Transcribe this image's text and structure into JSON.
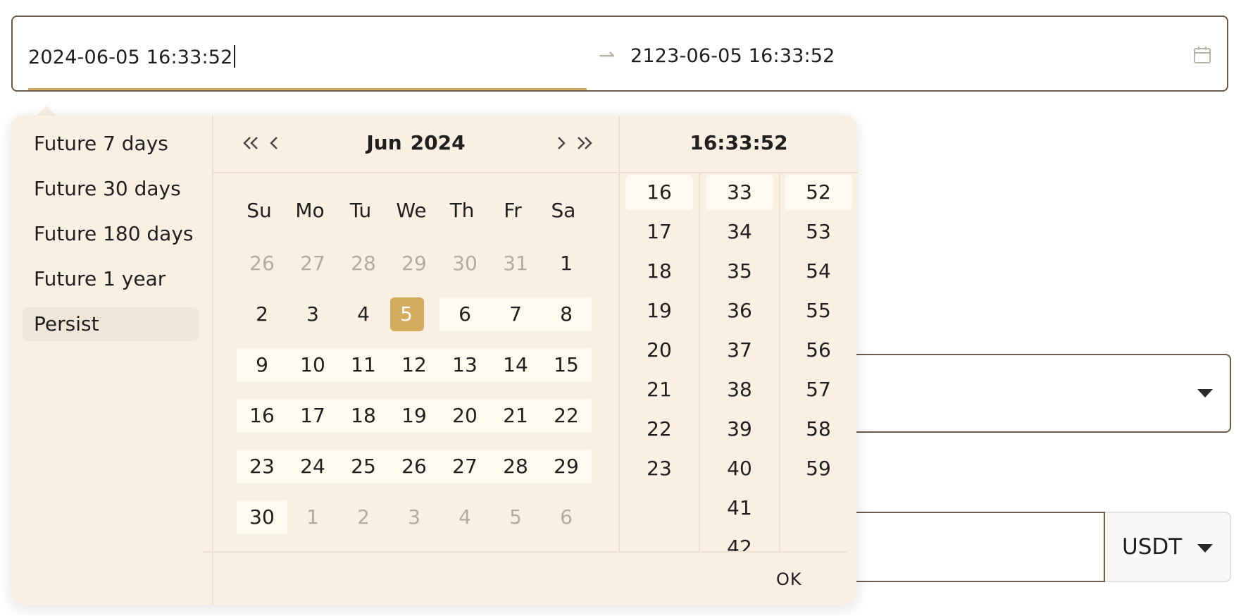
{
  "range": {
    "start": "2024-06-05 16:33:52",
    "separator": "⇀",
    "end": "2123-06-05 16:33:52"
  },
  "presets": [
    "Future 7 days",
    "Future 30 days",
    "Future 180 days",
    "Future 1 year",
    "Persist"
  ],
  "calendar": {
    "month": "Jun",
    "year": "2024",
    "weekdays": [
      "Su",
      "Mo",
      "Tu",
      "We",
      "Th",
      "Fr",
      "Sa"
    ],
    "weeks": [
      [
        {
          "d": "26",
          "s": "dim"
        },
        {
          "d": "27",
          "s": "dim"
        },
        {
          "d": "28",
          "s": "dim"
        },
        {
          "d": "29",
          "s": "dim"
        },
        {
          "d": "30",
          "s": "dim"
        },
        {
          "d": "31",
          "s": "dim"
        },
        {
          "d": "1",
          "s": ""
        }
      ],
      [
        {
          "d": "2",
          "s": ""
        },
        {
          "d": "3",
          "s": ""
        },
        {
          "d": "4",
          "s": ""
        },
        {
          "d": "5",
          "s": "sel"
        },
        {
          "d": "6",
          "s": "inrange"
        },
        {
          "d": "7",
          "s": "inrange"
        },
        {
          "d": "8",
          "s": "inrange"
        }
      ],
      [
        {
          "d": "9",
          "s": "inrange"
        },
        {
          "d": "10",
          "s": "inrange"
        },
        {
          "d": "11",
          "s": "inrange"
        },
        {
          "d": "12",
          "s": "inrange"
        },
        {
          "d": "13",
          "s": "inrange"
        },
        {
          "d": "14",
          "s": "inrange"
        },
        {
          "d": "15",
          "s": "inrange"
        }
      ],
      [
        {
          "d": "16",
          "s": "inrange"
        },
        {
          "d": "17",
          "s": "inrange"
        },
        {
          "d": "18",
          "s": "inrange"
        },
        {
          "d": "19",
          "s": "inrange"
        },
        {
          "d": "20",
          "s": "inrange"
        },
        {
          "d": "21",
          "s": "inrange"
        },
        {
          "d": "22",
          "s": "inrange"
        }
      ],
      [
        {
          "d": "23",
          "s": "inrange"
        },
        {
          "d": "24",
          "s": "inrange"
        },
        {
          "d": "25",
          "s": "inrange"
        },
        {
          "d": "26",
          "s": "inrange"
        },
        {
          "d": "27",
          "s": "inrange"
        },
        {
          "d": "28",
          "s": "inrange"
        },
        {
          "d": "29",
          "s": "inrange"
        }
      ],
      [
        {
          "d": "30",
          "s": "inrange"
        },
        {
          "d": "1",
          "s": "dim"
        },
        {
          "d": "2",
          "s": "dim"
        },
        {
          "d": "3",
          "s": "dim"
        },
        {
          "d": "4",
          "s": "dim"
        },
        {
          "d": "5",
          "s": "dim"
        },
        {
          "d": "6",
          "s": "dim"
        }
      ]
    ]
  },
  "time": {
    "title": "16:33:52",
    "hours": [
      "16",
      "17",
      "18",
      "19",
      "20",
      "21",
      "22",
      "23"
    ],
    "minutes": [
      "33",
      "34",
      "35",
      "36",
      "37",
      "38",
      "39",
      "40",
      "41",
      "42"
    ],
    "seconds": [
      "52",
      "53",
      "54",
      "55",
      "56",
      "57",
      "58",
      "59"
    ],
    "selected": {
      "hour": "16",
      "minute": "33",
      "second": "52"
    }
  },
  "ok_label": "OK",
  "currency": {
    "value": "USDT"
  },
  "colors": {
    "accent": "#d4ab5f",
    "popup_bg": "#f9f0e3",
    "border": "#6b5c48"
  },
  "icons": [
    "calendar-icon",
    "double-chevron-left-icon",
    "chevron-left-icon",
    "chevron-right-icon",
    "double-chevron-right-icon",
    "caret-down-icon"
  ]
}
